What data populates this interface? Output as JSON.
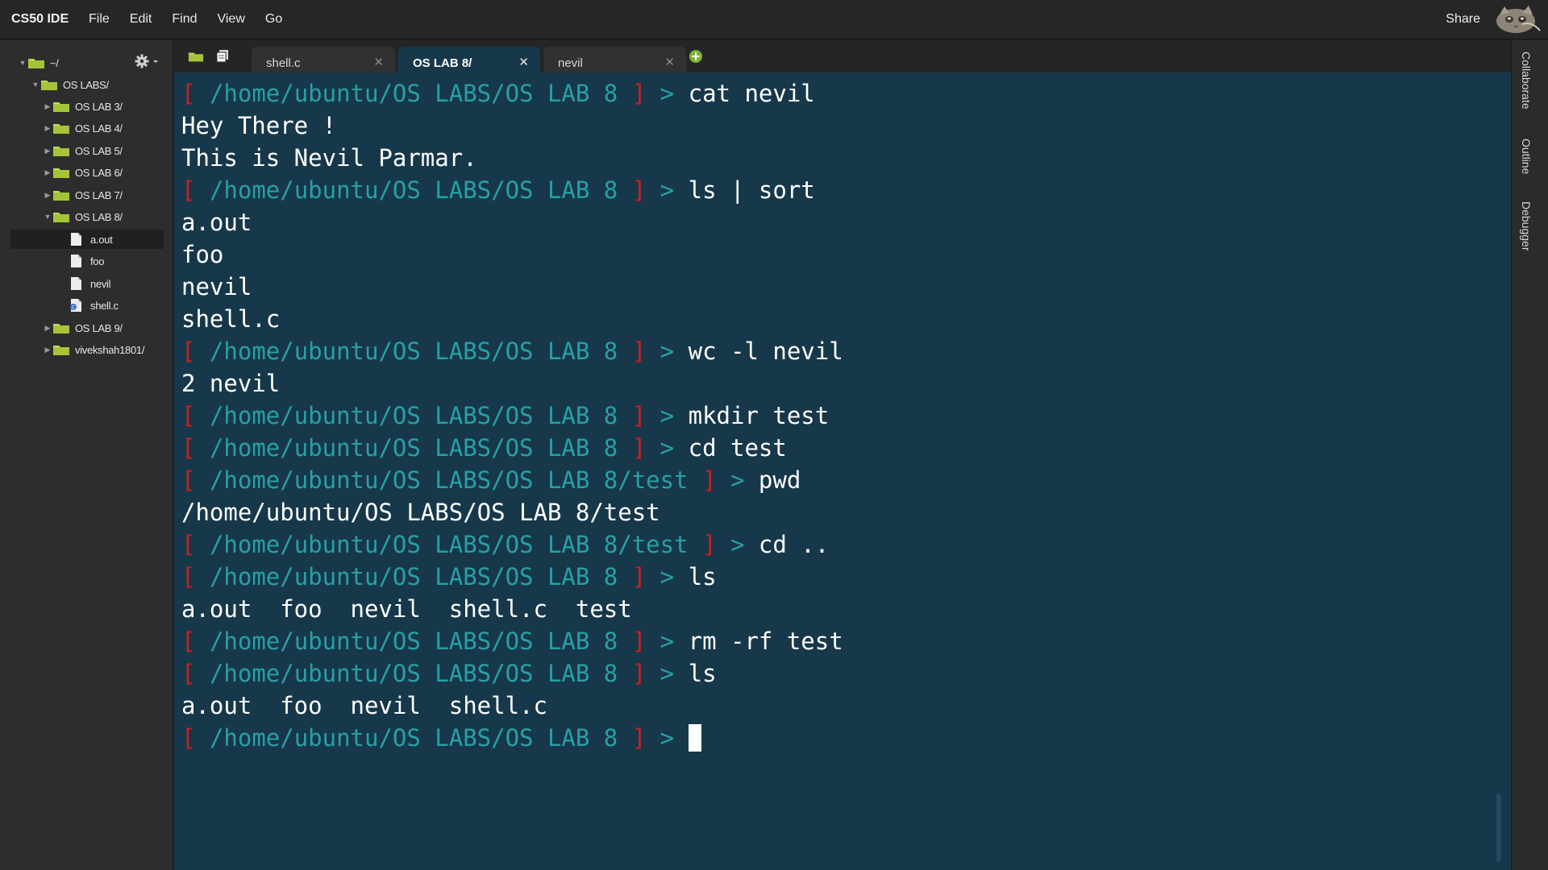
{
  "menubar": {
    "brand": "CS50 IDE",
    "menus": [
      "File",
      "Edit",
      "Find",
      "View",
      "Go"
    ],
    "share": "Share"
  },
  "sidebar": {
    "root": "~/",
    "items": [
      {
        "label": "OS LABS/",
        "type": "folder",
        "expanded": true
      },
      {
        "label": "OS LAB 3/",
        "type": "folder",
        "expanded": false
      },
      {
        "label": "OS LAB 4/",
        "type": "folder",
        "expanded": false
      },
      {
        "label": "OS LAB 5/",
        "type": "folder",
        "expanded": false
      },
      {
        "label": "OS LAB 6/",
        "type": "folder",
        "expanded": false
      },
      {
        "label": "OS LAB 7/",
        "type": "folder",
        "expanded": false
      },
      {
        "label": "OS LAB 8/",
        "type": "folder",
        "expanded": true
      },
      {
        "label": "a.out",
        "type": "file",
        "selected": true
      },
      {
        "label": "foo",
        "type": "file"
      },
      {
        "label": "nevil",
        "type": "file"
      },
      {
        "label": "shell.c",
        "type": "c-file"
      },
      {
        "label": "OS LAB 9/",
        "type": "folder",
        "expanded": false
      },
      {
        "label": "vivekshah1801/",
        "type": "folder",
        "expanded": false
      }
    ]
  },
  "tabs": [
    {
      "label": "shell.c",
      "active": false
    },
    {
      "label": "OS LAB 8/",
      "active": true
    },
    {
      "label": "nevil",
      "active": false
    }
  ],
  "terminal": {
    "prompt": {
      "open": "[",
      "close": "]",
      "caret": ">"
    },
    "lines": [
      {
        "kind": "prompt",
        "path": "/home/ubuntu/OS LABS/OS LAB 8",
        "cmd": "cat nevil"
      },
      {
        "kind": "out",
        "text": "Hey There !"
      },
      {
        "kind": "out",
        "text": "This is Nevil Parmar."
      },
      {
        "kind": "prompt",
        "path": "/home/ubuntu/OS LABS/OS LAB 8",
        "cmd": "ls | sort"
      },
      {
        "kind": "out",
        "text": "a.out"
      },
      {
        "kind": "out",
        "text": "foo"
      },
      {
        "kind": "out",
        "text": "nevil"
      },
      {
        "kind": "out",
        "text": "shell.c"
      },
      {
        "kind": "prompt",
        "path": "/home/ubuntu/OS LABS/OS LAB 8",
        "cmd": "wc -l nevil"
      },
      {
        "kind": "out",
        "text": "2 nevil"
      },
      {
        "kind": "prompt",
        "path": "/home/ubuntu/OS LABS/OS LAB 8",
        "cmd": "mkdir test"
      },
      {
        "kind": "prompt",
        "path": "/home/ubuntu/OS LABS/OS LAB 8",
        "cmd": "cd test"
      },
      {
        "kind": "prompt",
        "path": "/home/ubuntu/OS LABS/OS LAB 8/test",
        "cmd": "pwd"
      },
      {
        "kind": "out",
        "text": "/home/ubuntu/OS LABS/OS LAB 8/test"
      },
      {
        "kind": "prompt",
        "path": "/home/ubuntu/OS LABS/OS LAB 8/test",
        "cmd": "cd .."
      },
      {
        "kind": "prompt",
        "path": "/home/ubuntu/OS LABS/OS LAB 8",
        "cmd": "ls"
      },
      {
        "kind": "out",
        "text": "a.out  foo  nevil  shell.c  test"
      },
      {
        "kind": "prompt",
        "path": "/home/ubuntu/OS LABS/OS LAB 8",
        "cmd": "rm -rf test"
      },
      {
        "kind": "prompt",
        "path": "/home/ubuntu/OS LABS/OS LAB 8",
        "cmd": "ls"
      },
      {
        "kind": "out",
        "text": "a.out  foo  nevil  shell.c"
      },
      {
        "kind": "prompt",
        "path": "/home/ubuntu/OS LABS/OS LAB 8",
        "cmd": "",
        "cursor": true
      }
    ]
  },
  "rightrail": {
    "tabs": [
      "Collaborate",
      "Outline",
      "Debugger"
    ]
  },
  "icons": {
    "tree_expanded": "triangle-down-icon",
    "tree_collapsed": "triangle-right-icon",
    "folder": "folder-icon",
    "file": "file-icon",
    "c_file": "c-file-icon",
    "gear": "gear-icon",
    "tab_close": "close-icon",
    "new_tab": "plus-icon"
  },
  "colors": {
    "terminal_bg": "#17384a",
    "prompt_bracket": "#cc1f1f",
    "prompt_path": "#27a0a6",
    "folder": "#a6c43a",
    "new_tab": "#7db135"
  }
}
